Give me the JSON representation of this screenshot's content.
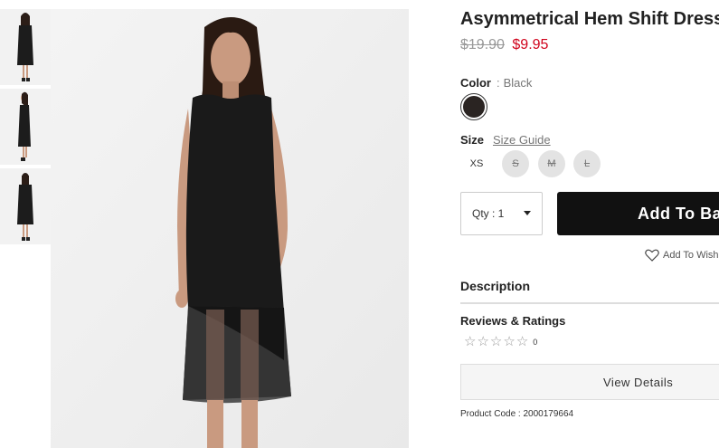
{
  "product": {
    "title": "Asymmetrical Hem Shift Dress",
    "price_original": "$19.90",
    "price_sale": "$9.95",
    "code": "Product Code : 2000179664"
  },
  "color": {
    "label": "Color",
    "separator": ":",
    "selected": "Black",
    "swatch_color": "#2a2422"
  },
  "size": {
    "label": "Size",
    "guide_link": "Size Guide",
    "options": [
      {
        "label": "XS",
        "available": true
      },
      {
        "label": "S",
        "available": false
      },
      {
        "label": "M",
        "available": false
      },
      {
        "label": "L",
        "available": false
      }
    ]
  },
  "quantity": {
    "label": "Qty : 1",
    "icon": "caret-down-icon"
  },
  "actions": {
    "add_to_bag": "Add To Ba",
    "wishlist": "Add To Wishl",
    "wishlist_icon": "heart-outline-icon"
  },
  "sections": {
    "description": "Description",
    "reviews": "Reviews & Ratings",
    "rating_count": "0",
    "rating_stars_filled": 0,
    "rating_stars_total": 5,
    "view_details": "View Details"
  },
  "gallery": {
    "thumbnail_count": 3,
    "accent_colors": {
      "background": "#efefef",
      "dress": "#1a1a1a",
      "sale_price": "#d0021b",
      "button": "#111111"
    }
  }
}
